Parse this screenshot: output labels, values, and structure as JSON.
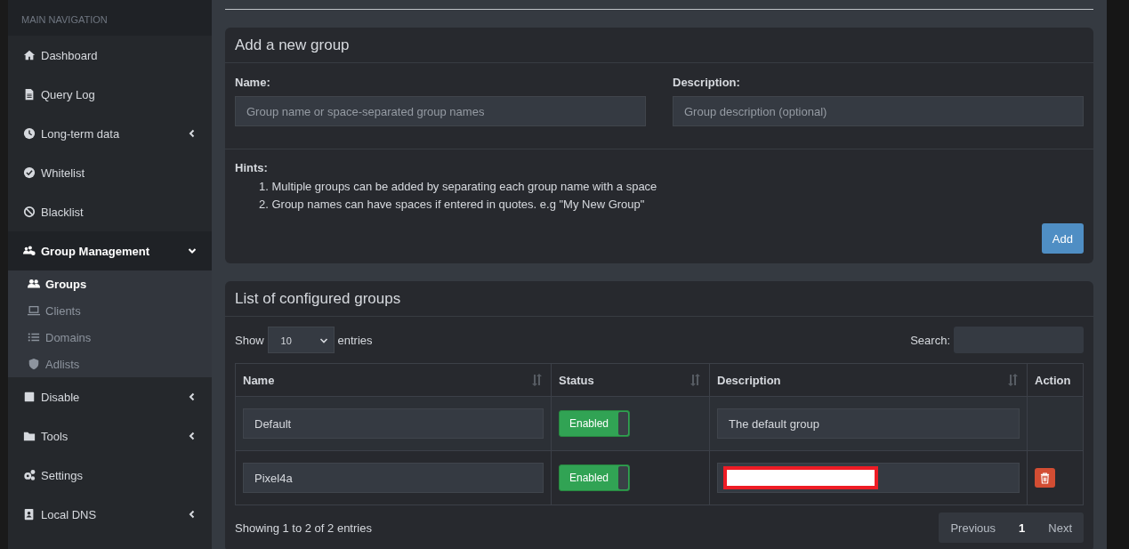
{
  "sidebar": {
    "header": "MAIN NAVIGATION",
    "items": [
      {
        "label": "Dashboard",
        "expandable": false,
        "expanded": false
      },
      {
        "label": "Query Log",
        "expandable": false,
        "expanded": false
      },
      {
        "label": "Long-term data",
        "expandable": true,
        "expanded": false
      },
      {
        "label": "Whitelist",
        "expandable": false,
        "expanded": false
      },
      {
        "label": "Blacklist",
        "expandable": false,
        "expanded": false
      },
      {
        "label": "Group Management",
        "expandable": true,
        "expanded": true,
        "children": [
          {
            "label": "Groups",
            "selected": true
          },
          {
            "label": "Clients",
            "selected": false
          },
          {
            "label": "Domains",
            "selected": false
          },
          {
            "label": "Adlists",
            "selected": false
          }
        ]
      },
      {
        "label": "Disable",
        "expandable": true,
        "expanded": false
      },
      {
        "label": "Tools",
        "expandable": true,
        "expanded": false
      },
      {
        "label": "Settings",
        "expandable": false,
        "expanded": false
      },
      {
        "label": "Local DNS",
        "expandable": true,
        "expanded": false
      }
    ]
  },
  "add_group": {
    "title": "Add a new group",
    "name_label": "Name:",
    "name_placeholder": "Group name or space-separated group names",
    "description_label": "Description:",
    "description_placeholder": "Group description (optional)",
    "hints_title": "Hints:",
    "hints": [
      "1. Multiple groups can be added by separating each group name with a space",
      "2. Group names can have spaces if entered in quotes. e.g \"My New Group\""
    ],
    "add_button": "Add"
  },
  "group_list": {
    "title": "List of configured groups",
    "show_label": "Show",
    "page_size": "10",
    "entries_label": "entries",
    "search_label": "Search:",
    "columns": [
      {
        "label": "Name",
        "sortable": true
      },
      {
        "label": "Status",
        "sortable": true
      },
      {
        "label": "Description",
        "sortable": true
      },
      {
        "label": "Action",
        "sortable": false
      }
    ],
    "rows": [
      {
        "name": "Default",
        "status": "Enabled",
        "on": true,
        "description": "The default group",
        "redacted": false,
        "deletable": false
      },
      {
        "name": "Pixel4a",
        "status": "Enabled",
        "on": true,
        "redacted": true,
        "deletable": true
      }
    ],
    "info": "Showing 1 to 2 of 2 entries",
    "pagination": [
      {
        "label": "Previous",
        "selected": false
      },
      {
        "label": "1",
        "selected": true
      },
      {
        "label": "Next",
        "selected": false
      }
    ]
  }
}
